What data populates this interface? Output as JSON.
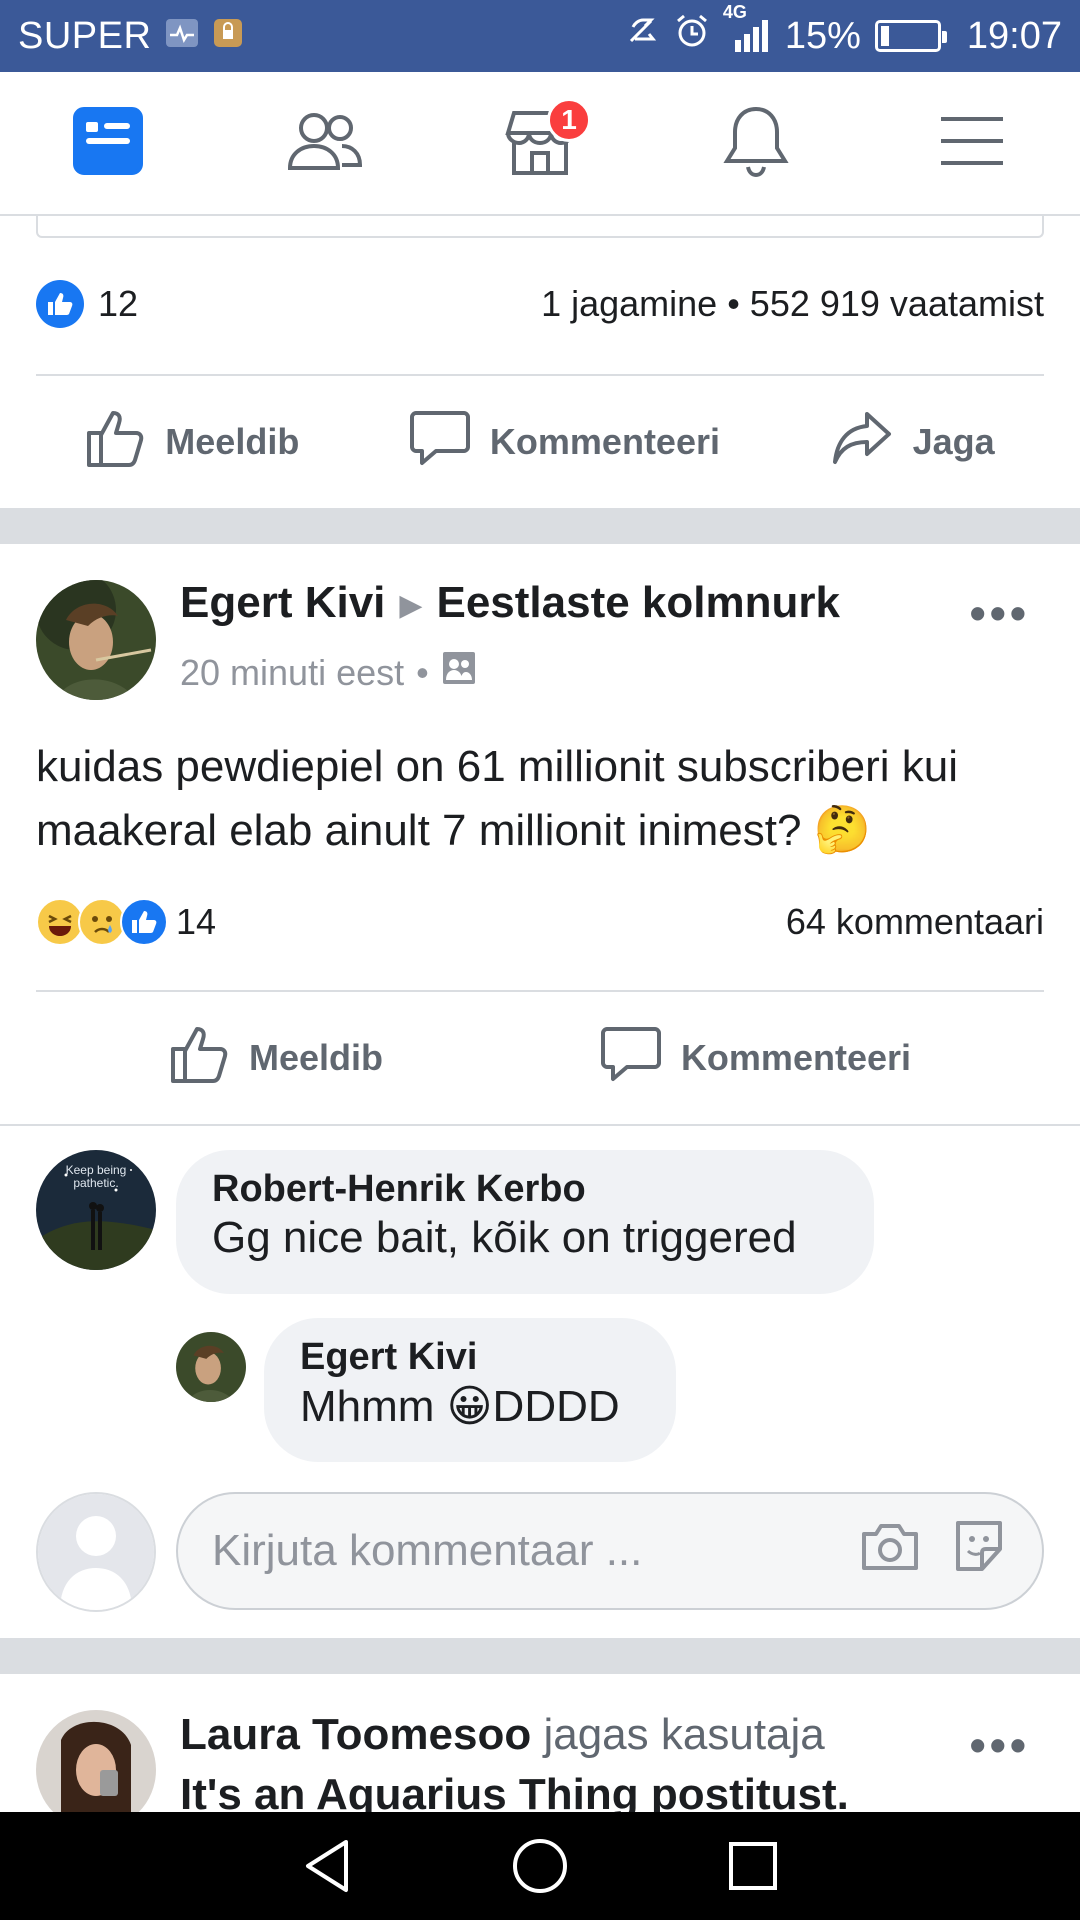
{
  "status_bar": {
    "carrier": "SUPER",
    "network": "4G",
    "battery": "15%",
    "time": "19:07"
  },
  "nav": {
    "items": [
      {
        "name": "news-feed",
        "active": true
      },
      {
        "name": "friends"
      },
      {
        "name": "marketplace",
        "badge": "1"
      },
      {
        "name": "notifications"
      },
      {
        "name": "menu"
      }
    ]
  },
  "prev_post": {
    "likes": "12",
    "stats": "1 jagamine • 552 919 vaatamist",
    "actions": {
      "like": "Meeldib",
      "comment": "Kommenteeri",
      "share": "Jaga"
    }
  },
  "post": {
    "author": "Egert Kivi",
    "group": "Eestlaste kolmnurk",
    "time": "20 minuti eest",
    "separator": "•",
    "text": "kuidas pewdiepiel on 61 millionit subscriberi kui maakeral elab ainult 7 millionit inimest?",
    "emoji": "🤔",
    "reactions_count": "14",
    "comments_count": "64 kommentaari",
    "actions": {
      "like": "Meeldib",
      "comment": "Kommenteeri"
    },
    "more": "•••"
  },
  "comments": [
    {
      "name": "Robert-Henrik Kerbo",
      "text": "Gg nice bait, kõik on triggered",
      "avatar_text": "Keep being pathetic."
    },
    {
      "name": "Egert Kivi",
      "text": "Mhmm",
      "emoji": "😀",
      "text_after": "DDDD"
    }
  ],
  "comment_input": {
    "placeholder": "Kirjuta kommentaar ..."
  },
  "next_post": {
    "author": "Laura Toomesoo",
    "action": "jagas kasutaja",
    "source": "It's an Aquarius Thing postitust.",
    "more": "•••"
  },
  "colors": {
    "facebook_blue": "#3b5998",
    "like_blue": "#1877f2",
    "badge_red": "#fa3e3e"
  }
}
